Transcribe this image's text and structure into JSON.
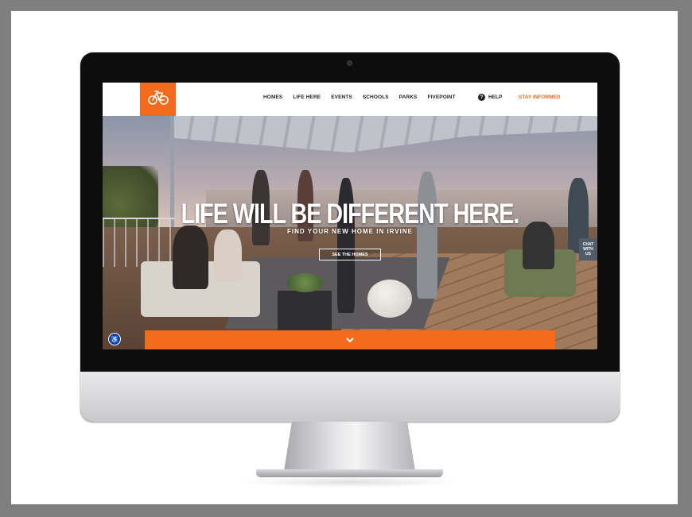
{
  "nav": {
    "items": [
      "HOMES",
      "LIFE HERE",
      "EVENTS",
      "SCHOOLS",
      "PARKS",
      "FIVEPOINT"
    ],
    "help_label": "HELP",
    "stay_informed_label": "STAY INFORMED",
    "logo_icon": "bicycle-icon"
  },
  "hero": {
    "headline": "LIFE WILL BE DIFFERENT HERE.",
    "subheadline": "FIND YOUR NEW HOME IN IRVINE",
    "cta_label": "SEE THE HOMES"
  },
  "chat": {
    "label_line1": "CHAT",
    "label_line2": "WITH",
    "label_line3": "US"
  },
  "colors": {
    "accent": "#f26a1b",
    "frame": "#7f7f80",
    "bezel": "#0d0d0e"
  },
  "icons": {
    "accessibility": "accessibility-icon",
    "scroll_down": "chevron-down-icon",
    "help": "question-circle-icon"
  }
}
